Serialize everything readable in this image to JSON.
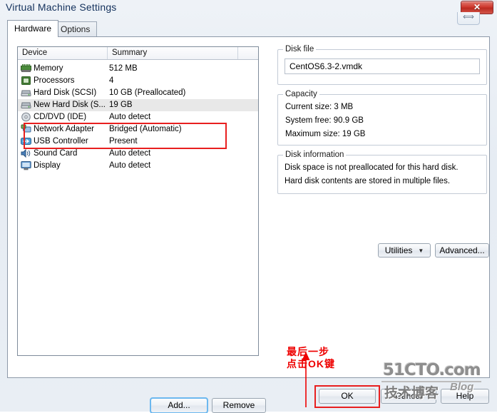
{
  "window": {
    "title": "Virtual Machine Settings",
    "close_icon": "close-icon",
    "resize_icon": "resize-horizontal-icon",
    "resize_glyph": "⟺",
    "close_glyph": "✕"
  },
  "tabs": [
    {
      "label": "Hardware",
      "active": true
    },
    {
      "label": "Options",
      "active": false
    }
  ],
  "device_list": {
    "columns": [
      "Device",
      "Summary",
      ""
    ],
    "rows": [
      {
        "icon": "memory-icon",
        "device": "Memory",
        "summary": "512 MB",
        "selected": false
      },
      {
        "icon": "processor-icon",
        "device": "Processors",
        "summary": "4",
        "selected": false
      },
      {
        "icon": "harddisk-icon",
        "device": "Hard Disk (SCSI)",
        "summary": "10 GB (Preallocated)",
        "selected": false
      },
      {
        "icon": "harddisk-icon",
        "device": "New Hard Disk (S...",
        "summary": "19 GB",
        "selected": true
      },
      {
        "icon": "cddvd-icon",
        "device": "CD/DVD (IDE)",
        "summary": "Auto detect",
        "selected": false
      },
      {
        "icon": "network-adapter-icon",
        "device": "Network Adapter",
        "summary": "Bridged (Automatic)",
        "selected": false
      },
      {
        "icon": "usb-icon",
        "device": "USB Controller",
        "summary": "Present",
        "selected": false
      },
      {
        "icon": "soundcard-icon",
        "device": "Sound Card",
        "summary": "Auto detect",
        "selected": false
      },
      {
        "icon": "display-icon",
        "device": "Display",
        "summary": "Auto detect",
        "selected": false
      }
    ]
  },
  "list_buttons": {
    "add": "Add...",
    "remove": "Remove"
  },
  "disk_file": {
    "group_title": "Disk file",
    "value": "CentOS6.3-2.vmdk"
  },
  "capacity": {
    "group_title": "Capacity",
    "lines": [
      "Current size: 3 MB",
      "System free: 90.9 GB",
      "Maximum size:  19 GB"
    ]
  },
  "disk_information": {
    "group_title": "Disk information",
    "lines": [
      "Disk space is not preallocated for this hard disk.",
      "Hard disk contents are stored in multiple files."
    ]
  },
  "disk_buttons": {
    "utilities": "Utilities",
    "utilities_caret": "▼",
    "advanced": "Advanced..."
  },
  "footer_buttons": {
    "ok": "OK",
    "cancel": "Cancel",
    "help": "Help"
  },
  "annotation": {
    "line1": "最后一步",
    "line2": "点击OK键",
    "color": "#ee0000"
  },
  "watermark": {
    "main": "51CTO.com",
    "sub": "技术博客",
    "blog": "Blog"
  },
  "colors": {
    "highlight_red": "#e81f1f",
    "title_text": "#13315c",
    "selection_gray": "#e8e8e8",
    "focus_blue": "#6cb8ef"
  }
}
